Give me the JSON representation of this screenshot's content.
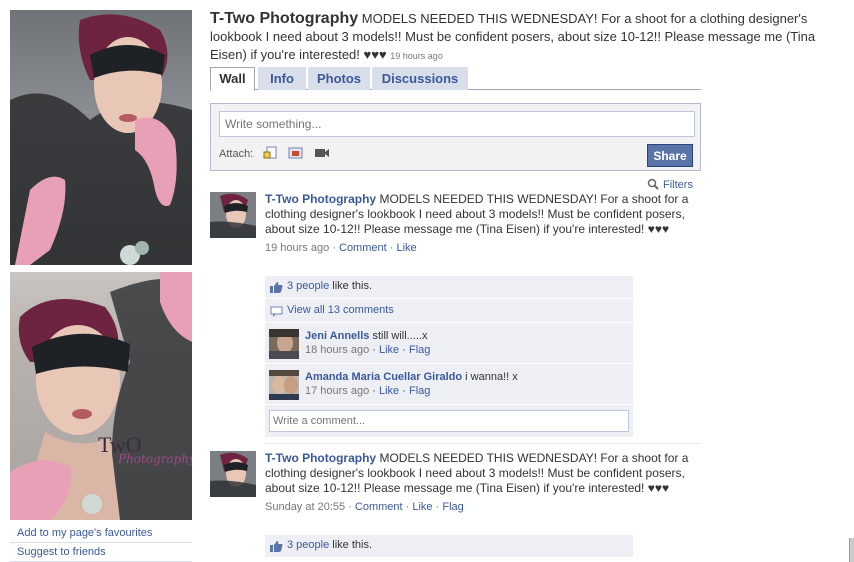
{
  "page": {
    "name": "T-Two Photography",
    "status_text": "MODELS NEEDED THIS WEDNESDAY! For a shoot for a clothing designer's lookbook I need about 3 models!! Must be confident posers, about size 10-12!! Please message me (Tina Eisen) if you're interested! ♥♥♥",
    "status_time": "19 hours ago"
  },
  "left": {
    "photo_watermark": "TwO",
    "photo_watermark_sub": "Photography",
    "links": [
      "Add to my page's favourites",
      "Suggest to friends"
    ]
  },
  "tabs": [
    "Wall",
    "Info",
    "Photos",
    "Discussions"
  ],
  "composer": {
    "placeholder": "Write something...",
    "attach_label": "Attach:",
    "share_label": "Share"
  },
  "filters_label": "Filters",
  "posts": [
    {
      "author": "T-Two Photography",
      "text": "MODELS NEEDED THIS WEDNESDAY! For a shoot for a clothing designer's lookbook I need about 3 models!! Must be confident posers, about size 10-12!! Please message me (Tina Eisen) if you're interested! ♥♥♥",
      "time": "19 hours ago",
      "actions": [
        "Comment",
        "Like"
      ],
      "likes_link": "3 people",
      "likes_suffix": " like this.",
      "view_all": "View all 13 comments",
      "comments": [
        {
          "author": "Jeni Annells",
          "text": "still will.....x",
          "time": "18 hours ago",
          "actions": [
            "Like",
            "Flag"
          ]
        },
        {
          "author": "Amanda Maria Cuellar Giraldo",
          "text": "i wanna!! x",
          "time": "17 hours ago",
          "actions": [
            "Like",
            "Flag"
          ]
        }
      ],
      "write_comment_placeholder": "Write a comment..."
    },
    {
      "author": "T-Two Photography",
      "text": "MODELS NEEDED THIS WEDNESDAY! For a shoot for a clothing designer's lookbook I need about 3 models!! Must be confident posers, about size 10-12!! Please message me (Tina Eisen) if you're interested! ♥♥♥",
      "time": "Sunday at 20:55",
      "actions": [
        "Comment",
        "Like",
        "Flag"
      ],
      "likes_link": "3 people",
      "likes_suffix": " like this."
    }
  ],
  "colors": {
    "link": "#3b5998",
    "tab_bg": "#d8dfea",
    "ufi_bg": "#edeff4",
    "share_btn": "#5b74a8"
  }
}
